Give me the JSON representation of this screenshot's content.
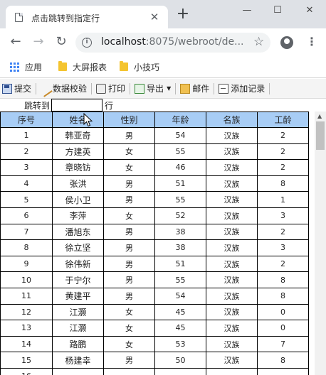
{
  "browser": {
    "tab_title": "点击跳转到指定行",
    "url_host": "localhost",
    "url_rest": ":8075/webroot/de...",
    "window_controls": [
      "minimize-icon",
      "maximize-icon",
      "close-icon"
    ]
  },
  "bookmarks": [
    {
      "label": "应用",
      "icon": "apps-grid-icon"
    },
    {
      "label": "大屏报表",
      "icon": "folder-icon"
    },
    {
      "label": "小技巧",
      "icon": "folder-icon"
    }
  ],
  "toolbar": {
    "submit": "提交",
    "validate": "数据校验",
    "print": "打印",
    "export": "导出",
    "mail": "邮件",
    "add_record": "添加记录"
  },
  "jump": {
    "label": "跳转到",
    "value": "",
    "suffix": "行"
  },
  "table": {
    "header_color": "#a8cdf5",
    "columns": [
      "序号",
      "姓名",
      "性别",
      "年龄",
      "名族",
      "工龄"
    ],
    "rows": [
      [
        "1",
        "韩亚奇",
        "男",
        "54",
        "汉族",
        "2"
      ],
      [
        "2",
        "方建英",
        "女",
        "55",
        "汉族",
        "2"
      ],
      [
        "3",
        "章晓钫",
        "女",
        "46",
        "汉族",
        "2"
      ],
      [
        "4",
        "张洪",
        "男",
        "51",
        "汉族",
        "8"
      ],
      [
        "5",
        "侯小卫",
        "男",
        "55",
        "汉族",
        "1"
      ],
      [
        "6",
        "李萍",
        "女",
        "52",
        "汉族",
        "3"
      ],
      [
        "7",
        "潘旭东",
        "男",
        "38",
        "汉族",
        "2"
      ],
      [
        "8",
        "徐立坚",
        "男",
        "38",
        "汉族",
        "3"
      ],
      [
        "9",
        "徐伟新",
        "男",
        "51",
        "汉族",
        "2"
      ],
      [
        "10",
        "于宁尔",
        "男",
        "55",
        "汉族",
        "8"
      ],
      [
        "11",
        "黄建平",
        "男",
        "54",
        "汉族",
        "8"
      ],
      [
        "12",
        "江灏",
        "女",
        "45",
        "汉族",
        "0"
      ],
      [
        "13",
        "江灏",
        "女",
        "45",
        "汉族",
        "0"
      ],
      [
        "14",
        "路鹏",
        "女",
        "53",
        "汉族",
        "7"
      ],
      [
        "15",
        "杨建幸",
        "男",
        "50",
        "汉族",
        "8"
      ],
      [
        "16",
        "",
        "",
        "",
        "",
        ""
      ]
    ]
  }
}
